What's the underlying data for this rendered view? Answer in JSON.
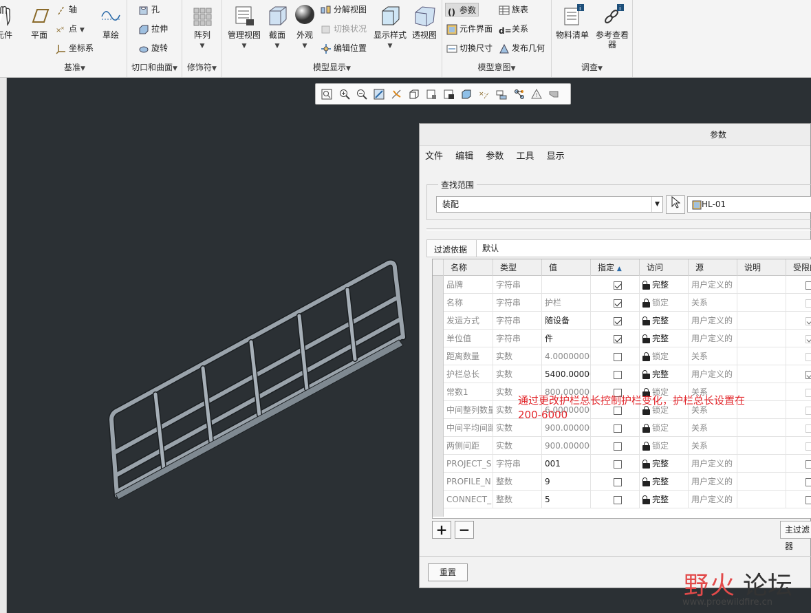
{
  "ribbon": {
    "partial_left": "元件",
    "datum": {
      "plane": "平面",
      "axis": "轴",
      "point": "点",
      "csys": "坐标系",
      "sketch": "草绘",
      "group": "基准"
    },
    "cut_surface": {
      "hole": "孔",
      "extrude": "拉伸",
      "revolve": "旋转",
      "group": "切口和曲面"
    },
    "modifiers": {
      "pattern": "阵列",
      "group": "修饰符"
    },
    "model_display": {
      "manage_views": "管理视图",
      "section": "截面",
      "appearance": "外观",
      "exploded_view": "分解视图",
      "toggle_status": "切换状况",
      "edit_position": "编辑位置",
      "display_style": "显示样式",
      "perspective": "透视图",
      "group": "模型显示"
    },
    "model_intent": {
      "params": "参数",
      "family_table": "族表",
      "component_interface": "元件界面",
      "relations": "关系",
      "toggle_dims": "切换尺寸",
      "publish_geom": "发布几何",
      "group": "模型意图"
    },
    "investigate": {
      "bom": "物料清单",
      "ref_viewer": "参考查看器",
      "group": "调查"
    }
  },
  "dialog": {
    "title": "参数",
    "menu": [
      "文件",
      "编辑",
      "参数",
      "工具",
      "显示"
    ],
    "scope_legend": "查找范围",
    "scope_value": "装配",
    "model_name": "HL-01",
    "filter_label": "过滤依据",
    "filter_value": "默认",
    "columns": [
      "名称",
      "类型",
      "值",
      "指定",
      "访问",
      "源",
      "说明",
      "受限的"
    ],
    "sorted_col_marker": "▲",
    "rows": [
      {
        "name": "品牌",
        "type": "字符串",
        "value": "",
        "designate": true,
        "access": "完整",
        "locked": false,
        "source": "用户定义的",
        "restricted": false,
        "rdis": false
      },
      {
        "name": "名称",
        "type": "字符串",
        "value": "护栏",
        "designate": true,
        "access": "锁定",
        "locked": true,
        "source": "关系",
        "restricted": false,
        "rdis": true
      },
      {
        "name": "发运方式",
        "type": "字符串",
        "value": "随设备",
        "designate": true,
        "access": "完整",
        "locked": false,
        "source": "用户定义的",
        "restricted": true,
        "rdis": true
      },
      {
        "name": "单位值",
        "type": "字符串",
        "value": "件",
        "designate": true,
        "access": "完整",
        "locked": false,
        "source": "用户定义的",
        "restricted": true,
        "rdis": true
      },
      {
        "name": "距离数量",
        "type": "实数",
        "value": "4.00000000",
        "designate": false,
        "access": "锁定",
        "locked": true,
        "source": "关系",
        "restricted": false,
        "rdis": true
      },
      {
        "name": "护栏总长",
        "type": "实数",
        "value": "5400.00000",
        "designate": false,
        "access": "完整",
        "locked": false,
        "source": "用户定义的",
        "restricted": true,
        "rdis": false
      },
      {
        "name": "常数1",
        "type": "实数",
        "value": "800.000000",
        "designate": false,
        "access": "锁定",
        "locked": true,
        "source": "关系",
        "restricted": false,
        "rdis": true
      },
      {
        "name": "中间整列数量",
        "type": "实数",
        "value": "6.00000000",
        "designate": false,
        "access": "锁定",
        "locked": true,
        "source": "关系",
        "restricted": false,
        "rdis": true
      },
      {
        "name": "中间平均间距",
        "type": "实数",
        "value": "900.000000",
        "designate": false,
        "access": "锁定",
        "locked": true,
        "source": "关系",
        "restricted": false,
        "rdis": true
      },
      {
        "name": "两侧间距",
        "type": "实数",
        "value": "900.000000",
        "designate": false,
        "access": "锁定",
        "locked": true,
        "source": "关系",
        "restricted": false,
        "rdis": true
      },
      {
        "name": "PROJECT_S",
        "type": "字符串",
        "value": "001",
        "designate": false,
        "access": "完整",
        "locked": false,
        "source": "用户定义的",
        "restricted": false,
        "rdis": false
      },
      {
        "name": "PROFILE_N",
        "type": "整数",
        "value": "9",
        "designate": false,
        "access": "完整",
        "locked": false,
        "source": "用户定义的",
        "restricted": false,
        "rdis": false
      },
      {
        "name": "CONNECT_",
        "type": "整数",
        "value": "5",
        "designate": false,
        "access": "完整",
        "locked": false,
        "source": "用户定义的",
        "restricted": false,
        "rdis": false
      }
    ],
    "add": "+",
    "remove": "−",
    "main_filter": "主过滤器",
    "reset": "重置"
  },
  "annotation": "通过更改护栏总长控制护栏变化，护栏总长设置在200-6000",
  "watermark": {
    "text1": "野火",
    "text2": "论坛",
    "url": "www.proewildfire.cn"
  },
  "colors": {
    "viewport": "#2b3034",
    "annotation": "#e3262b",
    "rail": "#9aa3ab"
  }
}
